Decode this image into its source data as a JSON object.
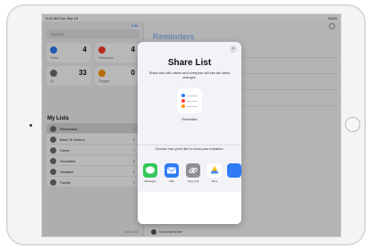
{
  "status": {
    "time": "9:41 AM Tue Sep 15",
    "battery": "100%"
  },
  "sidebar": {
    "edit_label": "Edit",
    "search_placeholder": "Search",
    "tiles": [
      {
        "label": "Today",
        "count": "4",
        "color": "#2f7cf6"
      },
      {
        "label": "Scheduled",
        "count": "4",
        "color": "#ff3b30"
      },
      {
        "label": "All",
        "count": "33",
        "color": "#6e6e73"
      },
      {
        "label": "Flagged",
        "count": "0",
        "color": "#ff9500"
      }
    ],
    "section_title": "My Lists",
    "lists": [
      {
        "name": "Reminders",
        "count": "4"
      },
      {
        "name": "Back To School",
        "count": "5"
      },
      {
        "name": "Home",
        "count": "7"
      },
      {
        "name": "Groceries",
        "count": "6"
      },
      {
        "name": "Vacation",
        "count": "5"
      },
      {
        "name": "Family",
        "count": "3"
      }
    ],
    "add_list_label": "Add List"
  },
  "detail": {
    "title": "Reminders",
    "new_reminder_label": "New Reminder"
  },
  "share_sheet": {
    "close_glyph": "✕",
    "title": "Share List",
    "description": "Share this with others and everyone will see the latest changes.",
    "list_name": "Reminders",
    "choose_text": "Choose how you'd like to send your invitation:",
    "apps": [
      {
        "label": "Messages",
        "color": "#34c759"
      },
      {
        "label": "Mail",
        "color": "#2f7cf6"
      },
      {
        "label": "Copy Link",
        "color": "#8e8e93"
      },
      {
        "label": "Drive",
        "color": "#ffffff"
      },
      {
        "label": "",
        "color": "#2f7cf6"
      }
    ]
  }
}
